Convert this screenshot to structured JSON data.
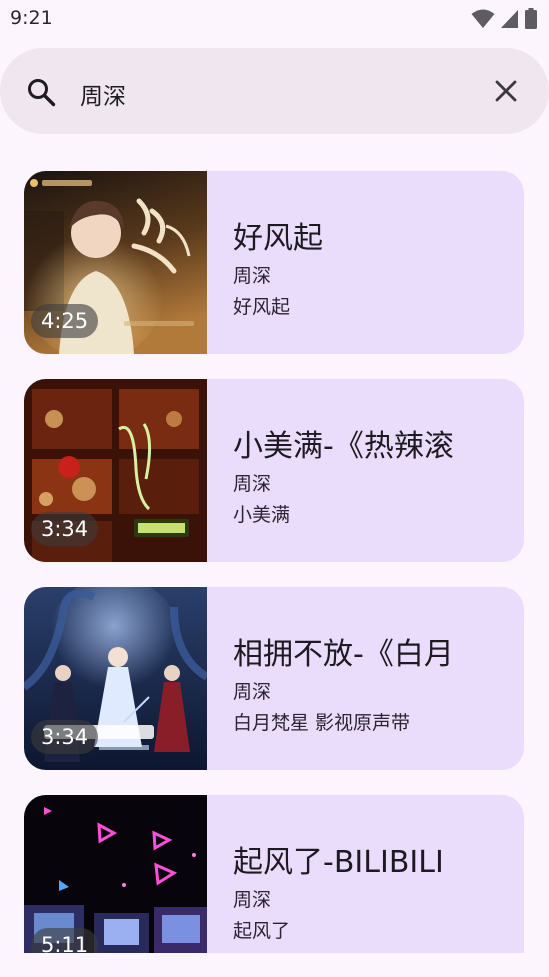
{
  "status_bar": {
    "time": "9:21",
    "icons": [
      "wifi-icon",
      "signal-icon",
      "battery-icon"
    ]
  },
  "search": {
    "query": "周深",
    "search_icon": "search-icon",
    "clear_icon": "close-icon"
  },
  "results": [
    {
      "title": "好风起",
      "artist": "周深",
      "album": "好风起",
      "duration": "4:25"
    },
    {
      "title": "小美满-《热辣滚",
      "artist": "周深",
      "album": "小美满",
      "duration": "3:34"
    },
    {
      "title": "相拥不放-《白月",
      "artist": "周深",
      "album": "白月梵星 影视原声带",
      "duration": "3:34"
    },
    {
      "title": "起风了-BILIBILI",
      "artist": "周深",
      "album": "起风了",
      "duration": "5:11"
    }
  ],
  "colors": {
    "background": "#fdf5fd",
    "search_bar": "#efe6f0",
    "card": "#eaddfb"
  }
}
